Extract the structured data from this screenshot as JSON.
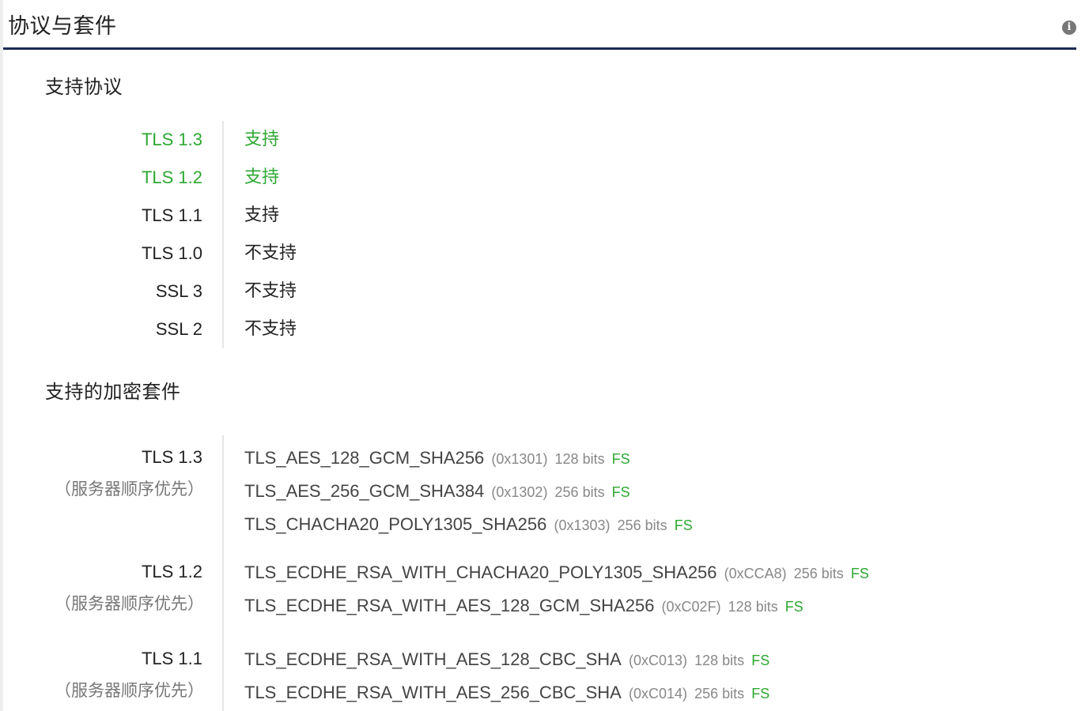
{
  "header": {
    "title": "协议与套件",
    "info_icon": "i"
  },
  "protocols": {
    "title": "支持协议",
    "rows": [
      {
        "name": "TLS 1.3",
        "status": "支持",
        "highlight": "green"
      },
      {
        "name": "TLS 1.2",
        "status": "支持",
        "highlight": "green"
      },
      {
        "name": "TLS 1.1",
        "status": "支持",
        "highlight": "dark"
      },
      {
        "name": "TLS 1.0",
        "status": "不支持",
        "highlight": "dark"
      },
      {
        "name": "SSL 3",
        "status": "不支持",
        "highlight": "dark"
      },
      {
        "name": "SSL 2",
        "status": "不支持",
        "highlight": "dark"
      }
    ]
  },
  "cipher_suites": {
    "title": "支持的加密套件",
    "groups": [
      {
        "version": "TLS 1.3",
        "order": "（服务器顺序优先）",
        "suites": [
          {
            "name": "TLS_AES_128_GCM_SHA256",
            "code": "(0x1301)",
            "bits": "128 bits",
            "fs": "FS"
          },
          {
            "name": "TLS_AES_256_GCM_SHA384",
            "code": "(0x1302)",
            "bits": "256 bits",
            "fs": "FS"
          },
          {
            "name": "TLS_CHACHA20_POLY1305_SHA256",
            "code": "(0x1303)",
            "bits": "256 bits",
            "fs": "FS"
          }
        ]
      },
      {
        "version": "TLS 1.2",
        "order": "（服务器顺序优先）",
        "suites": [
          {
            "name": "TLS_ECDHE_RSA_WITH_CHACHA20_POLY1305_SHA256",
            "code": "(0xCCA8)",
            "bits": "256 bits",
            "fs": "FS"
          },
          {
            "name": "TLS_ECDHE_RSA_WITH_AES_128_GCM_SHA256",
            "code": "(0xC02F)",
            "bits": "128 bits",
            "fs": "FS"
          }
        ]
      },
      {
        "version": "TLS 1.1",
        "order": "（服务器顺序优先）",
        "suites": [
          {
            "name": "TLS_ECDHE_RSA_WITH_AES_128_CBC_SHA",
            "code": "(0xC013)",
            "bits": "128 bits",
            "fs": "FS"
          },
          {
            "name": "TLS_ECDHE_RSA_WITH_AES_256_CBC_SHA",
            "code": "(0xC014)",
            "bits": "256 bits",
            "fs": "FS"
          }
        ]
      }
    ]
  },
  "colors": {
    "accent_green": "#2ea832",
    "header_rule": "#1c2a55",
    "muted_text": "#888888"
  }
}
